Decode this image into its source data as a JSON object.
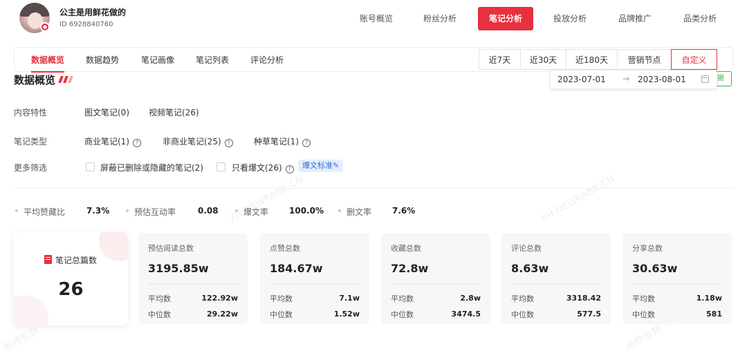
{
  "user": {
    "name": "公主是用鲜花做的",
    "id": "ID 6928840760"
  },
  "nav": [
    "账号概览",
    "粉丝分析",
    "笔记分析",
    "投放分析",
    "品牌推广",
    "品类分析"
  ],
  "sub_tabs": [
    "数据概览",
    "数据趋势",
    "笔记画像",
    "笔记列表",
    "评论分析"
  ],
  "ranges": [
    "近7天",
    "近30天",
    "近180天",
    "营销节点",
    "自定义"
  ],
  "date_picker": {
    "start": "2023-07-01",
    "arrow": "→",
    "end": "2023-08-01"
  },
  "export_stub": "据",
  "section_title": "数据概览",
  "filters": {
    "content_label": "内容特性",
    "content_items": [
      "图文笔记(0)",
      "视频笔记(26)"
    ],
    "type_label": "笔记类型",
    "type_items": [
      "商业笔记(1)",
      "非商业笔记(25)",
      "种草笔记(1)"
    ],
    "more_label": "更多筛选",
    "more_items": [
      "屏蔽已删除或隐藏的笔记(2)",
      "只看爆文(26)"
    ],
    "tag": "爆文标准✎"
  },
  "stats": [
    {
      "label": "平均赞藏比",
      "value": "7.3%"
    },
    {
      "label": "预估互动率",
      "value": "0.08"
    },
    {
      "label": "爆文率",
      "value": "100.0%"
    },
    {
      "label": "删文率",
      "value": "7.6%"
    }
  ],
  "total_card": {
    "label": "笔记总篇数",
    "value": "26"
  },
  "avg_label": "平均数",
  "median_label": "中位数",
  "cards": [
    {
      "label": "预估阅读总数",
      "value": "3195.85w",
      "avg": "122.92w",
      "median": "29.22w"
    },
    {
      "label": "点赞总数",
      "value": "184.67w",
      "avg": "7.1w",
      "median": "1.52w"
    },
    {
      "label": "收藏总数",
      "value": "72.8w",
      "avg": "2.8w",
      "median": "3474.5"
    },
    {
      "label": "评论总数",
      "value": "8.63w",
      "avg": "3318.42",
      "median": "577.5"
    },
    {
      "label": "分享总数",
      "value": "30.63w",
      "avg": "1.18w",
      "median": "581"
    }
  ],
  "watermarks": [
    "新榜有数 · 新红",
    "XH.NEWRANK.CN"
  ],
  "colors": {
    "accent": "#e8303f",
    "tag_blue": "#2f6fd6",
    "card_bg": "#f6f7f9"
  }
}
